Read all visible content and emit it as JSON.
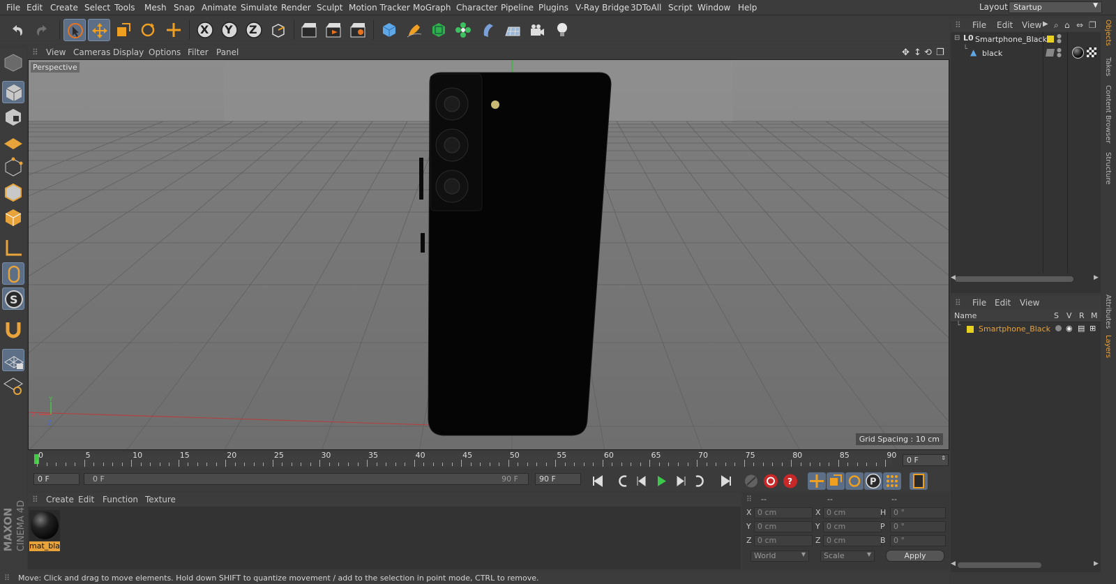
{
  "menubar": {
    "items": [
      "File",
      "Edit",
      "Create",
      "Select",
      "Tools",
      "Mesh",
      "Snap",
      "Animate",
      "Simulate",
      "Render",
      "Sculpt",
      "Motion Tracker",
      "MoGraph",
      "Character",
      "Pipeline",
      "Plugins",
      "V-Ray Bridge",
      "3DToAll",
      "Script",
      "Window",
      "Help"
    ],
    "layout_label": "Layout:",
    "layout_value": "Startup"
  },
  "toolbar": {
    "undo": "undo-icon",
    "redo": "redo-icon",
    "axis_x": "X",
    "axis_y": "Y",
    "axis_z": "Z"
  },
  "viewport": {
    "menu": [
      "View",
      "Cameras",
      "Display",
      "Options",
      "Filter",
      "Panel"
    ],
    "camera_label": "Perspective",
    "grid_spacing": "Grid Spacing : 10 cm",
    "axis_y": "Y",
    "axis_x": "X",
    "axis_z": "Z"
  },
  "timeline": {
    "ticks": [
      "0",
      "5",
      "10",
      "15",
      "20",
      "25",
      "30",
      "35",
      "40",
      "45",
      "50",
      "55",
      "60",
      "65",
      "70",
      "75",
      "80",
      "85",
      "90"
    ],
    "current_frame_field": "0 F",
    "start_field": "0 F",
    "range_start": "0 F",
    "range_end": "90 F",
    "end_field": "90 F"
  },
  "material_manager": {
    "menu": [
      "Create",
      "Edit",
      "Function",
      "Texture"
    ],
    "materials": [
      {
        "name": "mat_bla"
      }
    ]
  },
  "coordinates": {
    "headers": [
      "--",
      "--",
      "--"
    ],
    "rows": [
      {
        "l1": "X",
        "v1": "0 cm",
        "l2": "X",
        "v2": "0 cm",
        "l3": "H",
        "v3": "0 °"
      },
      {
        "l1": "Y",
        "v1": "0 cm",
        "l2": "Y",
        "v2": "0 cm",
        "l3": "P",
        "v3": "0 °"
      },
      {
        "l1": "Z",
        "v1": "0 cm",
        "l2": "Z",
        "v2": "0 cm",
        "l3": "B",
        "v3": "0 °"
      }
    ],
    "space": "World",
    "mode": "Scale",
    "apply": "Apply"
  },
  "status": "Move: Click and drag to move elements. Hold down SHIFT to quantize movement / add to the selection in point mode, CTRL to remove.",
  "object_manager": {
    "menu": [
      "File",
      "Edit",
      "View"
    ],
    "objects": [
      {
        "name": "Smartphone_Black",
        "layer_color": "#e8d020"
      },
      {
        "name": "black"
      }
    ]
  },
  "layer_manager": {
    "menu": [
      "File",
      "Edit",
      "View"
    ],
    "columns": {
      "name": "Name",
      "s": "S",
      "v": "V",
      "r": "R",
      "m": "M"
    },
    "layers": [
      {
        "name": "Smartphone_Black",
        "color": "#e8d020"
      }
    ]
  },
  "side_tabs": [
    "Objects",
    "Takes",
    "Content Browser",
    "Structure",
    "Attributes",
    "Layers"
  ],
  "branding": {
    "maxon": "MAXON",
    "product": "CINEMA 4D"
  },
  "colors": {
    "accent": "#e8a33a",
    "selected_tool": "#5c6f86",
    "layer_yellow": "#e8d020"
  }
}
